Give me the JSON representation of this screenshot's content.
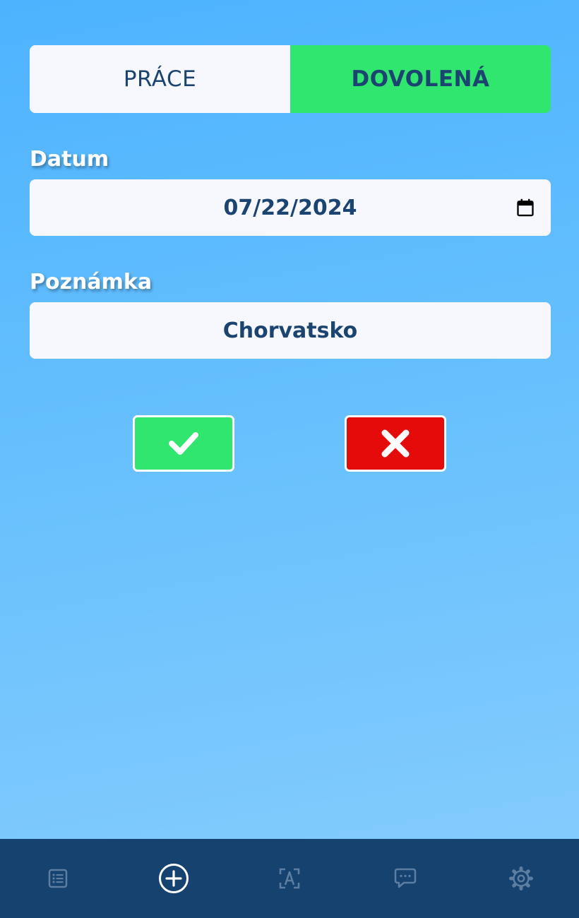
{
  "tabs": {
    "work_label": "PRÁCE",
    "vacation_label": "DOVOLENÁ",
    "active": "vacation"
  },
  "date_field": {
    "label": "Datum",
    "value": "07/22/2024",
    "icon": "calendar-icon"
  },
  "note_field": {
    "label": "Poznámka",
    "value": "Chorvatsko"
  },
  "actions": {
    "confirm_icon": "check-icon",
    "cancel_icon": "close-icon"
  },
  "nav": {
    "items": [
      {
        "icon": "list-icon",
        "active": false
      },
      {
        "icon": "add-circle-icon",
        "active": true
      },
      {
        "icon": "text-recognition-icon",
        "active": false
      },
      {
        "icon": "chat-icon",
        "active": false
      },
      {
        "icon": "gear-icon",
        "active": false
      }
    ]
  },
  "colors": {
    "accent_green": "#30e66e",
    "danger_red": "#e60b0b",
    "nav_bg": "#15426f",
    "text_dark": "#1c4470"
  }
}
